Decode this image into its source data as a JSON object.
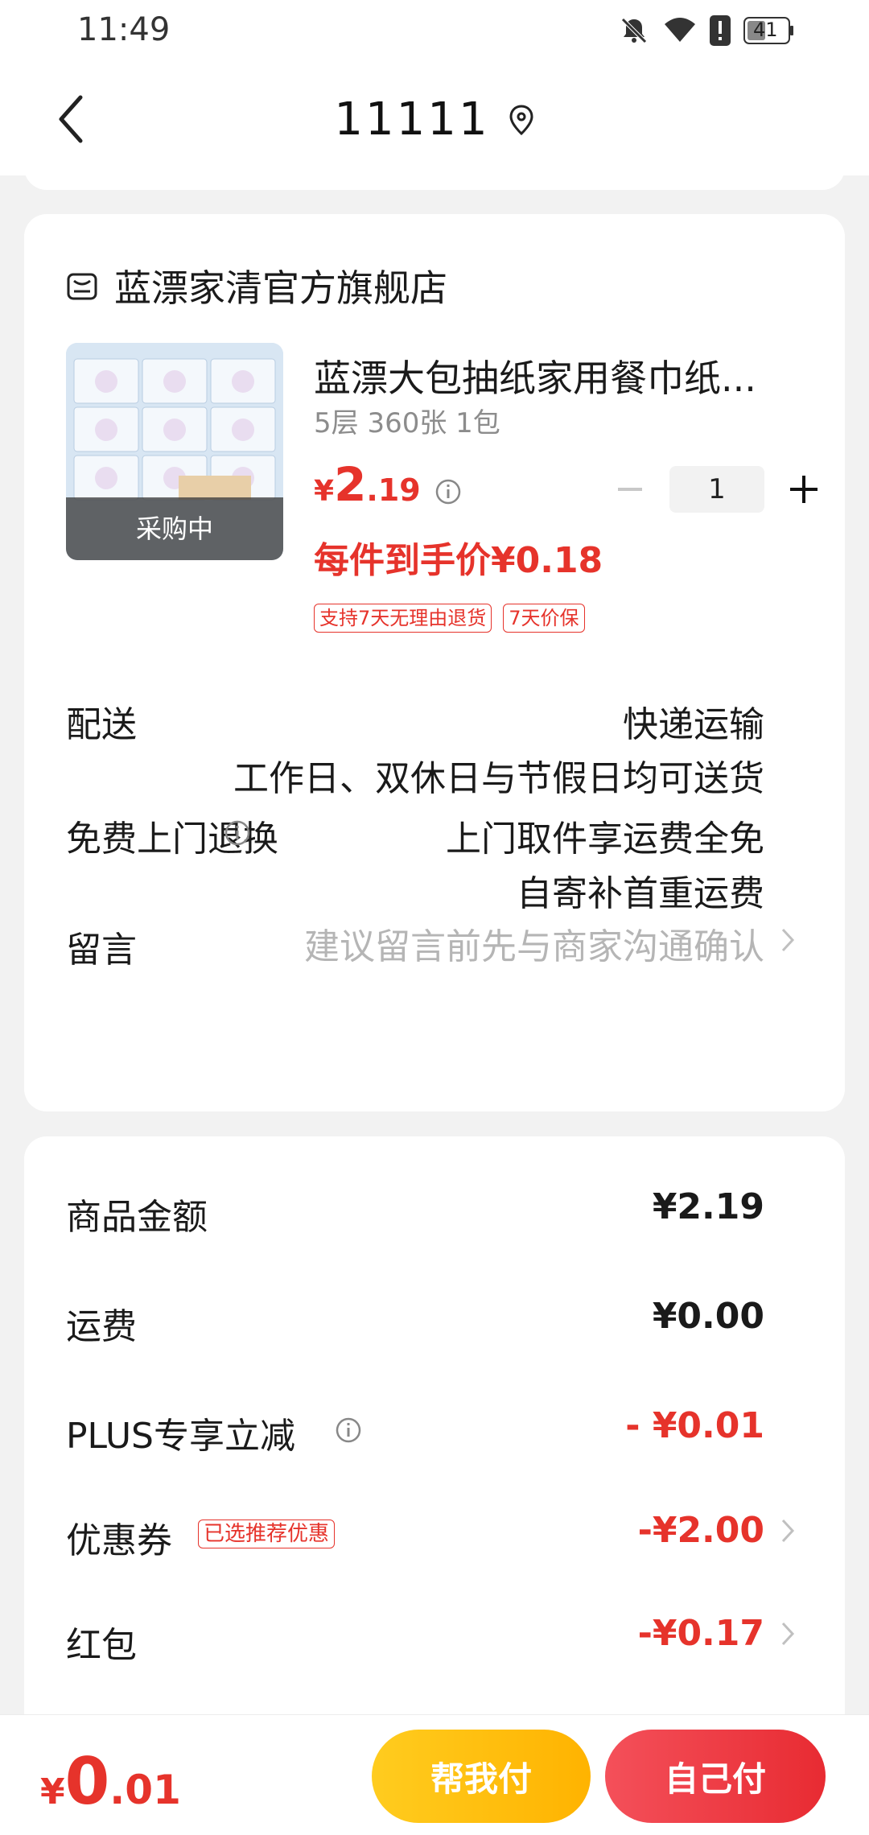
{
  "status_bar": {
    "time": "11:49",
    "battery": "41"
  },
  "nav": {
    "title": "11111"
  },
  "store": {
    "name": "蓝漂家清官方旗舰店",
    "product": {
      "title": "蓝漂大包抽纸家用餐巾纸...",
      "spec": "5层 360张 1包",
      "badge": "采购中",
      "price_symbol": "¥",
      "price_int": "2",
      "price_dec": ".19",
      "quantity": "1",
      "deal_price": "每件到手价¥0.18",
      "tags": [
        "支持7天无理由退货",
        "7天价保"
      ]
    },
    "delivery": {
      "label": "配送",
      "method": "快递运输",
      "note": "工作日、双休日与节假日均可送货"
    },
    "return": {
      "label": "免费上门退换",
      "line1": "上门取件享运费全免",
      "line2": "自寄补首重运费"
    },
    "message": {
      "label": "留言",
      "placeholder": "建议留言前先与商家沟通确认"
    }
  },
  "summary": {
    "goods": {
      "label": "商品金额",
      "value": "¥2.19"
    },
    "shipping": {
      "label": "运费",
      "value": "¥0.00"
    },
    "plus": {
      "label": "PLUS专享立减",
      "value": "- ¥0.01"
    },
    "coupon": {
      "label": "优惠券",
      "tag": "已选推荐优惠",
      "value": "-¥2.00"
    },
    "redpacket": {
      "label": "红包",
      "value": "-¥0.17"
    }
  },
  "footer": {
    "total_symbol": "¥",
    "total_int": "0",
    "total_dec": ".01",
    "help_pay": "帮我付",
    "self_pay": "自己付"
  },
  "colors": {
    "accent_red": "#e6332b",
    "help_button": "#ffbf10",
    "self_button": "#ec3a40"
  }
}
